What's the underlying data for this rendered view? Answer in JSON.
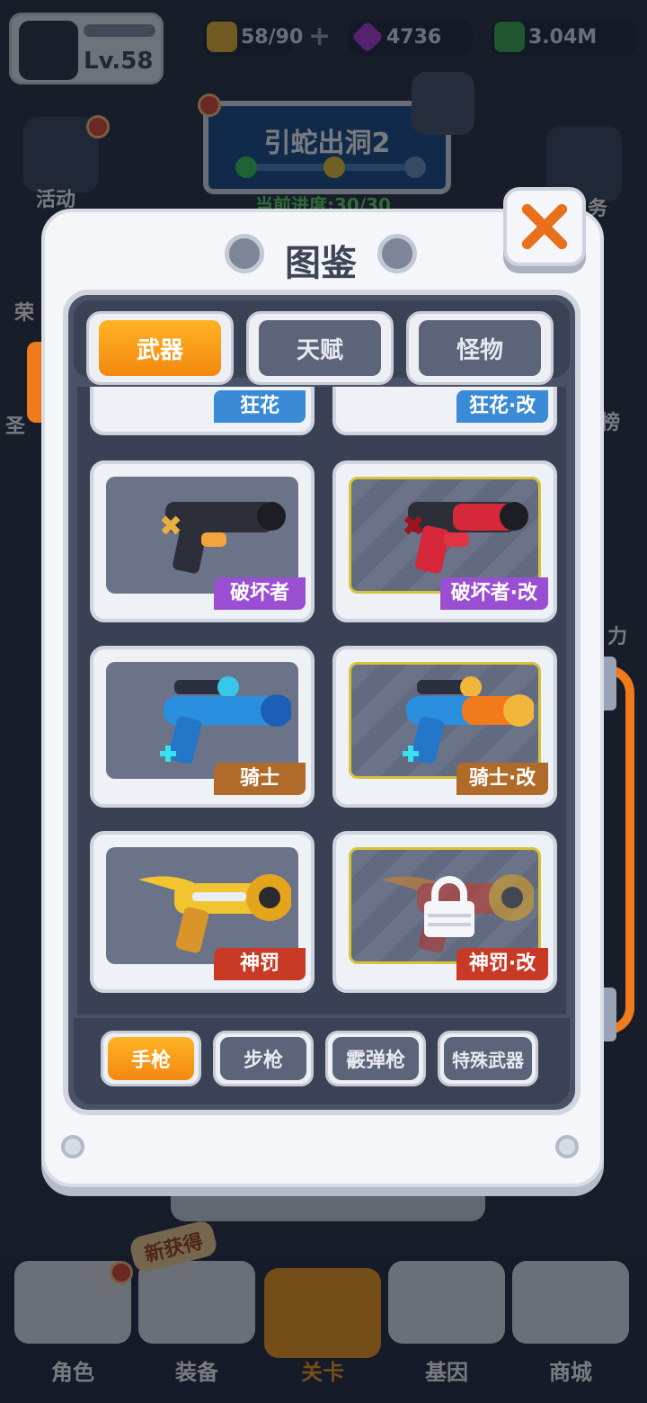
{
  "hud": {
    "level": "Lv.58",
    "energy": "58/90",
    "gems": "4736",
    "cash": "3.04M"
  },
  "stage": {
    "name": "引蛇出洞2",
    "progress": "当前进度:30/30"
  },
  "side_labels": {
    "activity": "活动",
    "left2": "荣",
    "left3": "圣",
    "right1": "务",
    "right2": "榜",
    "right3": "力"
  },
  "modal": {
    "title": "图鉴",
    "tabs": [
      {
        "label": "武器",
        "active": true
      },
      {
        "label": "天赋",
        "active": false
      },
      {
        "label": "怪物",
        "active": false
      }
    ],
    "partial_labels": [
      "狂花",
      "狂花·改"
    ],
    "weapons": [
      {
        "name": "破坏者",
        "color": "purple",
        "modified": false
      },
      {
        "name": "破坏者·改",
        "color": "purple",
        "modified": true
      },
      {
        "name": "骑士",
        "color": "bronze",
        "modified": false
      },
      {
        "name": "骑士·改",
        "color": "bronze",
        "modified": true
      },
      {
        "name": "神罚",
        "color": "red",
        "modified": false
      },
      {
        "name": "神罚·改",
        "color": "red",
        "modified": true,
        "locked": true
      }
    ],
    "subtabs": [
      {
        "label": "手枪",
        "active": true
      },
      {
        "label": "步枪",
        "active": false
      },
      {
        "label": "霰弹枪",
        "active": false
      },
      {
        "label": "特殊武器",
        "active": false
      }
    ]
  },
  "bottom_nav": {
    "new_badge": "新获得",
    "items": [
      "角色",
      "装备",
      "关卡",
      "基因",
      "商城"
    ],
    "active": "关卡"
  },
  "colors": {
    "accent_orange": "#f28810",
    "purple": "#9a4fd3",
    "bronze": "#b06b2a",
    "red": "#c83a26"
  }
}
